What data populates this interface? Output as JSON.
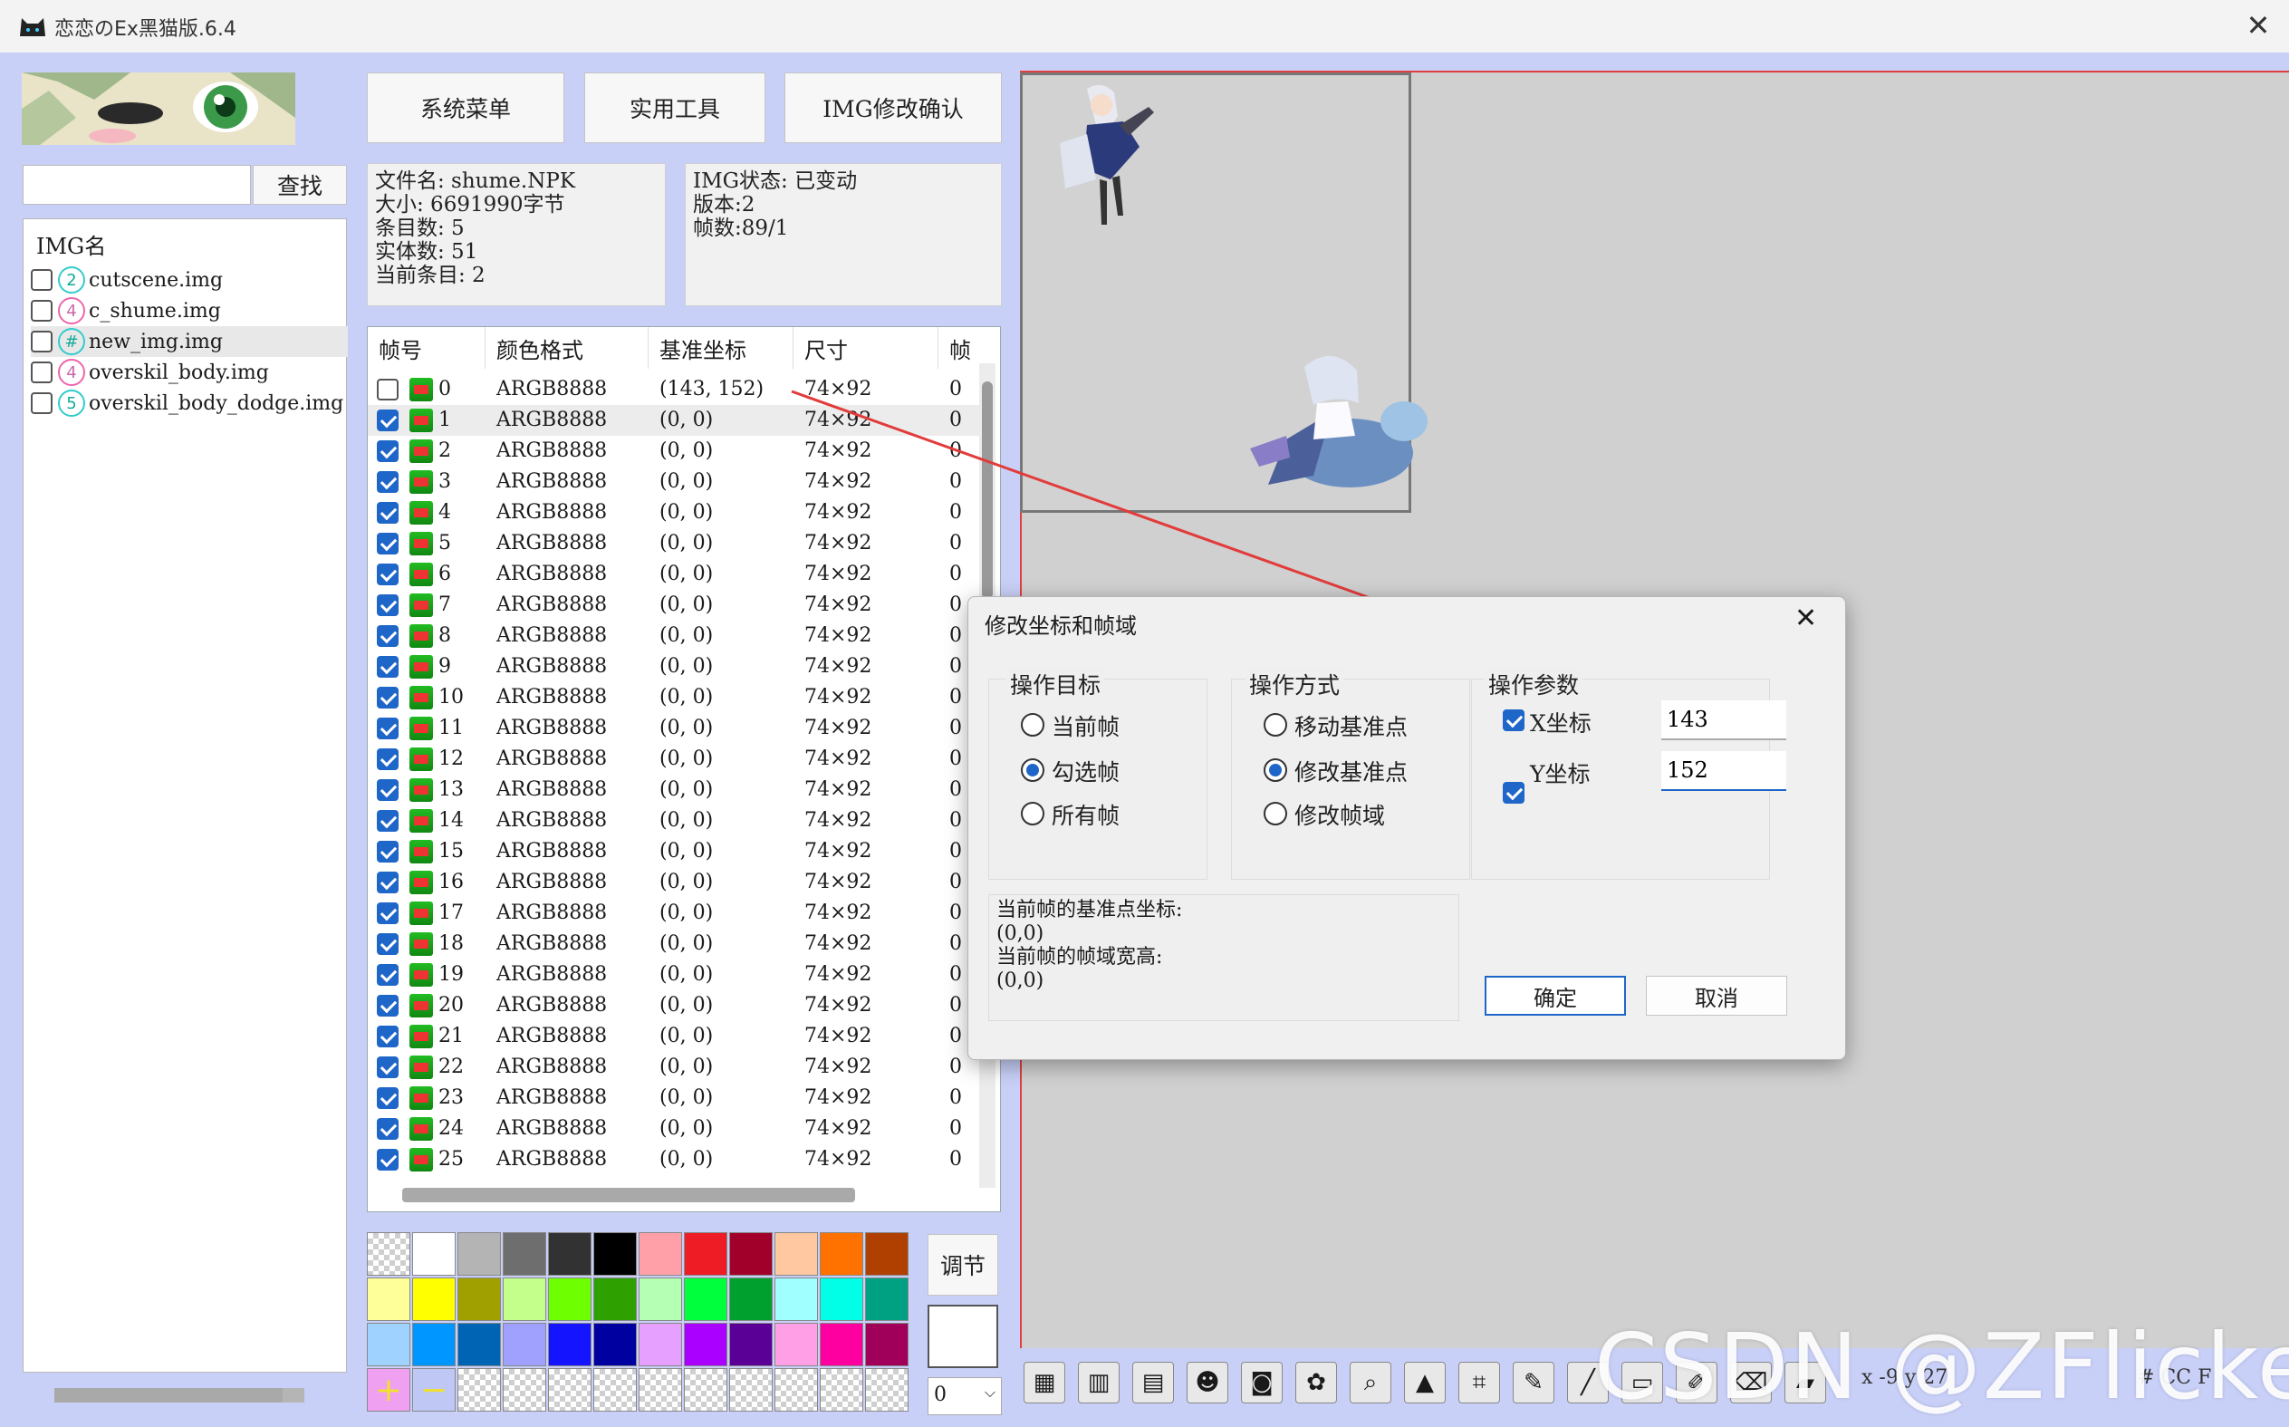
{
  "window": {
    "title": "恋恋のEx黑猫版.6.4"
  },
  "toolbar_buttons": {
    "system_menu": "系统菜单",
    "utilities": "实用工具",
    "img_confirm": "IMG修改确认"
  },
  "search": {
    "value": "",
    "button": "查找"
  },
  "file_info": {
    "name": "文件名: shume.NPK",
    "size": "大小: 6691990字节",
    "entries": "条目数: 5",
    "entities": "实体数: 51",
    "current": "当前条目: 2"
  },
  "img_info": {
    "status": "IMG状态: 已变动",
    "version": "版本:2",
    "frames": "帧数:89/1"
  },
  "img_list": {
    "header": "IMG名",
    "items": [
      {
        "icon": "2",
        "name": "cutscene.img",
        "selected": false
      },
      {
        "icon": "4",
        "name": "c_shume.img",
        "selected": false
      },
      {
        "icon": "#",
        "name": "new_img.img",
        "selected": true
      },
      {
        "icon": "4",
        "name": "overskil_body.img",
        "selected": false
      },
      {
        "icon": "5",
        "name": "overskil_body_dodge.img",
        "selected": false
      }
    ]
  },
  "frame_table": {
    "headers": [
      "帧号",
      "颜色格式",
      "基准坐标",
      "尺寸",
      "帧"
    ],
    "rows": [
      {
        "n": "0",
        "fmt": "ARGB8888",
        "pos": "(143, 152)",
        "size": "74×92",
        "chk": false
      },
      {
        "n": "1",
        "fmt": "ARGB8888",
        "pos": "(0, 0)",
        "size": "74×92",
        "chk": true
      },
      {
        "n": "2",
        "fmt": "ARGB8888",
        "pos": "(0, 0)",
        "size": "74×92",
        "chk": true
      },
      {
        "n": "3",
        "fmt": "ARGB8888",
        "pos": "(0, 0)",
        "size": "74×92",
        "chk": true
      },
      {
        "n": "4",
        "fmt": "ARGB8888",
        "pos": "(0, 0)",
        "size": "74×92",
        "chk": true
      },
      {
        "n": "5",
        "fmt": "ARGB8888",
        "pos": "(0, 0)",
        "size": "74×92",
        "chk": true
      },
      {
        "n": "6",
        "fmt": "ARGB8888",
        "pos": "(0, 0)",
        "size": "74×92",
        "chk": true
      },
      {
        "n": "7",
        "fmt": "ARGB8888",
        "pos": "(0, 0)",
        "size": "74×92",
        "chk": true
      },
      {
        "n": "8",
        "fmt": "ARGB8888",
        "pos": "(0, 0)",
        "size": "74×92",
        "chk": true
      },
      {
        "n": "9",
        "fmt": "ARGB8888",
        "pos": "(0, 0)",
        "size": "74×92",
        "chk": true
      },
      {
        "n": "10",
        "fmt": "ARGB8888",
        "pos": "(0, 0)",
        "size": "74×92",
        "chk": true
      },
      {
        "n": "11",
        "fmt": "ARGB8888",
        "pos": "(0, 0)",
        "size": "74×92",
        "chk": true
      },
      {
        "n": "12",
        "fmt": "ARGB8888",
        "pos": "(0, 0)",
        "size": "74×92",
        "chk": true
      },
      {
        "n": "13",
        "fmt": "ARGB8888",
        "pos": "(0, 0)",
        "size": "74×92",
        "chk": true
      },
      {
        "n": "14",
        "fmt": "ARGB8888",
        "pos": "(0, 0)",
        "size": "74×92",
        "chk": true
      },
      {
        "n": "15",
        "fmt": "ARGB8888",
        "pos": "(0, 0)",
        "size": "74×92",
        "chk": true
      },
      {
        "n": "16",
        "fmt": "ARGB8888",
        "pos": "(0, 0)",
        "size": "74×92",
        "chk": true
      },
      {
        "n": "17",
        "fmt": "ARGB8888",
        "pos": "(0, 0)",
        "size": "74×92",
        "chk": true
      },
      {
        "n": "18",
        "fmt": "ARGB8888",
        "pos": "(0, 0)",
        "size": "74×92",
        "chk": true
      },
      {
        "n": "19",
        "fmt": "ARGB8888",
        "pos": "(0, 0)",
        "size": "74×92",
        "chk": true
      },
      {
        "n": "20",
        "fmt": "ARGB8888",
        "pos": "(0, 0)",
        "size": "74×92",
        "chk": true
      },
      {
        "n": "21",
        "fmt": "ARGB8888",
        "pos": "(0, 0)",
        "size": "74×92",
        "chk": true
      },
      {
        "n": "22",
        "fmt": "ARGB8888",
        "pos": "(0, 0)",
        "size": "74×92",
        "chk": true
      },
      {
        "n": "23",
        "fmt": "ARGB8888",
        "pos": "(0, 0)",
        "size": "74×92",
        "chk": true
      },
      {
        "n": "24",
        "fmt": "ARGB8888",
        "pos": "(0, 0)",
        "size": "74×92",
        "chk": true
      },
      {
        "n": "25",
        "fmt": "ARGB8888",
        "pos": "(0, 0)",
        "size": "74×92",
        "chk": true
      }
    ],
    "trailing_col_value": "0"
  },
  "palette": {
    "colors": [
      "checker",
      "#ffffff",
      "#b4b4b4",
      "#6e6e6e",
      "#323232",
      "#000000",
      "#ffa0a8",
      "#ee1c24",
      "#a0002a",
      "#ffc8a0",
      "#ff7200",
      "#b04000",
      "#ffff99",
      "#ffff00",
      "#a0a000",
      "#c4ff8c",
      "#6eff00",
      "#2ea000",
      "#b4ffb4",
      "#00ff3c",
      "#00a02e",
      "#a0ffff",
      "#00ffe6",
      "#00a082",
      "#a0d2ff",
      "#0096ff",
      "#0064b4",
      "#a0a0ff",
      "#1414ff",
      "#0000a0",
      "#e6a0ff",
      "#aa00ff",
      "#5a0096",
      "#ffa0e6",
      "#ff00a0",
      "#a0005a",
      "plus",
      "minus",
      "empty",
      "empty",
      "empty",
      "empty",
      "empty",
      "empty",
      "empty",
      "empty",
      "empty",
      "empty"
    ],
    "adjust_label": "调节",
    "select_value": "0"
  },
  "dialog": {
    "title": "修改坐标和帧域",
    "target": {
      "legend": "操作目标",
      "options": [
        "当前帧",
        "勾选帧",
        "所有帧"
      ],
      "selected": 1
    },
    "mode": {
      "legend": "操作方式",
      "options": [
        "移动基准点",
        "修改基准点",
        "修改帧域"
      ],
      "selected": 1
    },
    "params": {
      "legend": "操作参数",
      "x_label": "X坐标",
      "x_value": "143",
      "y_label": "Y坐标",
      "y_value": "152"
    },
    "info": {
      "line1": "当前帧的基准点坐标:",
      "line2": "(0,0)",
      "line3": "当前帧的帧域宽高:",
      "line4": "(0,0)"
    },
    "ok": "确定",
    "cancel": "取消"
  },
  "status": {
    "coords": "x -9 y 27",
    "color": "# CC F"
  },
  "watermark": "CSDN @ZFlicker",
  "colors": {
    "accent": "#1f66c9",
    "client_bg": "#c9d0f8",
    "arrow": "#e23b3b"
  }
}
